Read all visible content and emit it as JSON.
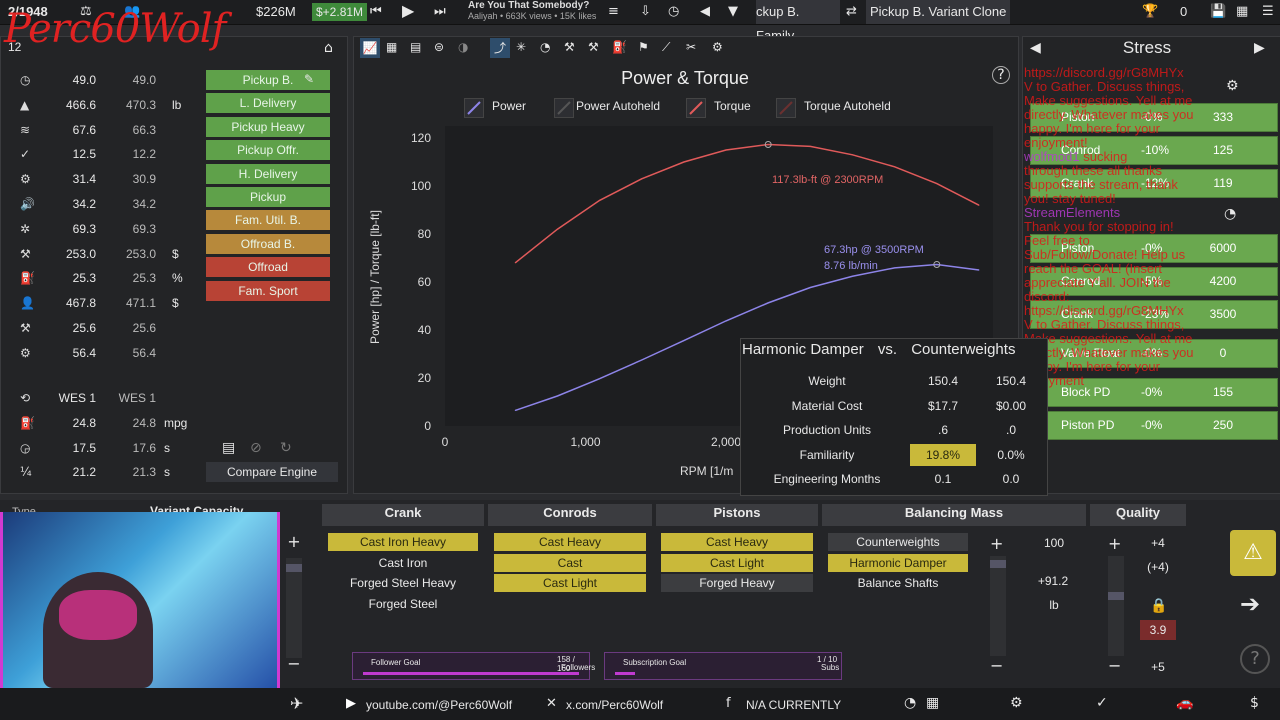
{
  "topbar": {
    "year": "2/1948",
    "money": "$226M",
    "income": "$+2.81M",
    "song_title": "Are You That Somebody?",
    "song_artist": "Aaliyah • 663K views • 15K likes",
    "tab1": "ckup B. Family",
    "tab2": "Pickup B. Variant Clone",
    "count": "0"
  },
  "overlay": {
    "streamer_logo": "Perc60Wolf",
    "left_num": "12"
  },
  "stats": [
    {
      "icon": "gauge-icon",
      "a": "49.0",
      "b": "49.0",
      "unit": ""
    },
    {
      "icon": "weight-icon",
      "a": "466.6",
      "b": "470.3",
      "unit": "lb"
    },
    {
      "icon": "wind-icon",
      "a": "67.6",
      "b": "66.3",
      "unit": ""
    },
    {
      "icon": "wrench-icon",
      "a": "12.5",
      "b": "12.2",
      "unit": ""
    },
    {
      "icon": "engine-icon",
      "a": "31.4",
      "b": "30.9",
      "unit": ""
    },
    {
      "icon": "speaker-icon",
      "a": "34.2",
      "b": "34.2",
      "unit": ""
    },
    {
      "icon": "cog-icon",
      "a": "69.3",
      "b": "69.3",
      "unit": ""
    },
    {
      "icon": "tools-icon",
      "a": "253.0",
      "b": "253.0",
      "unit": "$"
    },
    {
      "icon": "fuel-icon",
      "a": "25.3",
      "b": "25.3",
      "unit": "%"
    },
    {
      "icon": "person-icon",
      "a": "467.8",
      "b": "471.1",
      "unit": "$"
    },
    {
      "icon": "hammer-icon",
      "a": "25.6",
      "b": "25.6",
      "unit": ""
    },
    {
      "icon": "gear-icon",
      "a": "56.4",
      "b": "56.4",
      "unit": ""
    }
  ],
  "stats2": [
    {
      "icon": "cycle-icon",
      "a": "WES 1",
      "b": "WES 1",
      "unit": ""
    },
    {
      "icon": "fuel-icon",
      "a": "24.8",
      "b": "24.8",
      "unit": "mpg"
    },
    {
      "icon": "timer-icon",
      "a": "17.5",
      "b": "17.6",
      "unit": "s"
    },
    {
      "icon": "quarter-mile-icon",
      "a": "21.2",
      "b": "21.3",
      "unit": "s"
    }
  ],
  "variants": [
    {
      "label": "Pickup B.",
      "color": "#5fa14a"
    },
    {
      "label": "L. Delivery",
      "color": "#5fa14a"
    },
    {
      "label": "Pickup Heavy",
      "color": "#5fa14a"
    },
    {
      "label": "Pickup Offr.",
      "color": "#5fa14a"
    },
    {
      "label": "H. Delivery",
      "color": "#5fa14a"
    },
    {
      "label": "Pickup",
      "color": "#5fa14a"
    },
    {
      "label": "Fam. Util. B.",
      "color": "#b7893b"
    },
    {
      "label": "Offroad B.",
      "color": "#b7893b"
    },
    {
      "label": "Offroad",
      "color": "#b84335"
    },
    {
      "label": "Fam. Sport",
      "color": "#b84335"
    }
  ],
  "compare_engine": "Compare Engine",
  "graph": {
    "title": "Power & Torque",
    "legend": [
      "Power",
      "Power Autoheld",
      "Torque",
      "Torque Autoheld"
    ],
    "torque_label": "117.3lb-ft @ 2300RPM",
    "power_label": "67.3hp @ 3500RPM",
    "power_label2": "8.76 lb/min"
  },
  "chart_data": {
    "type": "line",
    "title": "Power & Torque",
    "xlabel": "RPM [1/m",
    "ylabel": "Power [hp] / Torque [lb-ft]",
    "xlim": [
      0,
      3900
    ],
    "ylim": [
      0,
      125
    ],
    "x_ticks": [
      "0",
      "1,000",
      "2,000"
    ],
    "y_ticks": [
      "0",
      "20",
      "40",
      "60",
      "80",
      "100",
      "120"
    ],
    "series": [
      {
        "name": "Torque",
        "color": "#e05a5a",
        "x": [
          500,
          800,
          1100,
          1400,
          1700,
          2000,
          2300,
          2600,
          2900,
          3200,
          3500,
          3800
        ],
        "y": [
          68,
          82,
          94,
          103,
          110,
          115,
          117.3,
          116.5,
          113,
          108,
          101,
          92
        ]
      },
      {
        "name": "Power",
        "color": "#8d84e8",
        "x": [
          500,
          800,
          1100,
          1400,
          1700,
          2000,
          2300,
          2600,
          2900,
          3200,
          3500,
          3800
        ],
        "y": [
          6.5,
          12.5,
          19.7,
          27.5,
          35.6,
          43.8,
          51.3,
          57.7,
          62.4,
          65.9,
          67.3,
          65
        ]
      }
    ]
  },
  "stress": {
    "title": "Stress",
    "rows": [
      {
        "name": "Piston",
        "pct": "-0%",
        "val": "333"
      },
      {
        "name": "Conrod",
        "pct": "-10%",
        "val": "125"
      },
      {
        "name": "Crank",
        "pct": "-12%",
        "val": "119"
      },
      {
        "name": "Piston",
        "pct": "-0%",
        "val": "6000"
      },
      {
        "name": "Conrod",
        "pct": "-5%",
        "val": "4200"
      },
      {
        "name": "Crank",
        "pct": "-23%",
        "val": "3500"
      },
      {
        "name": "Valve Float",
        "pct": "-0%",
        "val": "0"
      },
      {
        "name": "Block PD",
        "pct": "-0%",
        "val": "155"
      },
      {
        "name": "Piston PD",
        "pct": "-0%",
        "val": "250"
      }
    ]
  },
  "compare": {
    "left": "Harmonic Damper",
    "vs": "vs.",
    "right": "Counterweights",
    "rows": [
      {
        "label": "Weight",
        "a": "150.4",
        "b": "150.4"
      },
      {
        "label": "Material Cost",
        "a": "$17.7",
        "b": "$0.00"
      },
      {
        "label": "Production Units",
        "a": ".6",
        "b": ".0"
      },
      {
        "label": "Familiarity",
        "a": "19.8%",
        "b": "0.0%"
      },
      {
        "label": "Engineering Months",
        "a": "0.1",
        "b": "0.0"
      }
    ]
  },
  "bottom": {
    "type_label": "Type",
    "variant_capacity": "Variant Capacity",
    "crank": {
      "title": "Crank",
      "options": [
        "Cast Iron Heavy",
        "Cast Iron",
        "Forged Steel Heavy",
        "Forged Steel"
      ]
    },
    "conrods": {
      "title": "Conrods",
      "options": [
        "Cast Heavy",
        "Cast",
        "Cast Light"
      ]
    },
    "pistons": {
      "title": "Pistons",
      "options": [
        "Cast Heavy",
        "Cast Light",
        "Forged Heavy"
      ]
    },
    "balancing": {
      "title": "Balancing Mass",
      "options": [
        "Counterweights",
        "Harmonic Damper",
        "Balance Shafts"
      ],
      "value": "100",
      "delta": "+91.2",
      "unit": "lb"
    },
    "quality": {
      "title": "Quality",
      "v1": "+4",
      "v2": "(+4)",
      "v3": "3.9",
      "v4": "+5"
    },
    "follower_goal": "Follower Goal",
    "follower_count": "158 / 160",
    "followers_word": "Followers",
    "sub_goal": "Subscription Goal",
    "sub_count": "1 / 10",
    "subs_word": "Subs"
  },
  "social": {
    "youtube": "youtube.com/@Perc60Wolf",
    "x": "x.com/Perc60Wolf",
    "current": "N/A CURRENTLY"
  },
  "chat": {
    "l1": "https://discord.gg/rG8MHYx",
    "l2": "V to Gather. Discuss things,",
    "l3": "Make suggestions. Yell at me",
    "l4": "directly. Whatever makes you",
    "l5": "happy. I'm here for your",
    "l6": "enjoyment!",
    "user1": "wolfmod1",
    "l7": "sucking",
    "l8": "through these all thanks",
    "l9": "supports the stream, thank",
    "l10": "you! stay tuned!",
    "user2": "StreamElements",
    "l11": "Thank you for stopping in!",
    "l12": "Feel free to",
    "l13": "Sub/Follow/Donate! Help us",
    "l14": "reach the GOAL! (Insert",
    "l15": "appreciate Y'all. JOIN the",
    "l16": "discord:",
    "l17": "https://discord.gg/rG8MHYx",
    "l18": "V to Gather. Discuss things,",
    "l19": "Make suggestions. Yell at me",
    "l20": "directly. Whatever makes you",
    "l21": "happy. I'm here for your",
    "l22": "enjoyment"
  }
}
